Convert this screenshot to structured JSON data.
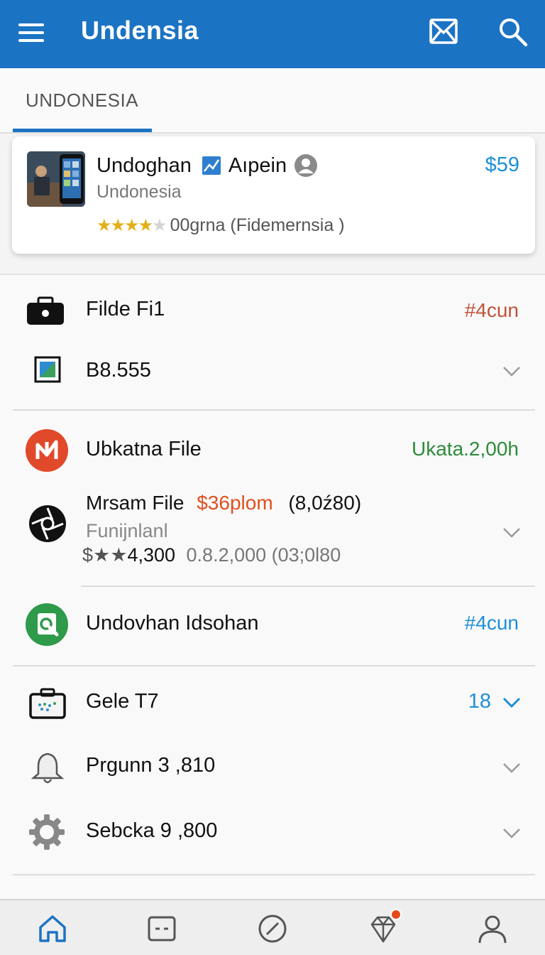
{
  "app": {
    "title": "Undensia"
  },
  "tabs": [
    {
      "label": "UNDONESIA",
      "active": true
    }
  ],
  "card": {
    "name": "Undoghan",
    "name_suffix": "Aıpein",
    "subtitle": "Undonesia",
    "price": "$59",
    "rating_stars": 4,
    "rating_text": "00grna (Fidemernsia )"
  },
  "list": {
    "row1": {
      "label": "Filde Fi1",
      "meta": "#4cun"
    },
    "row2": {
      "label": "B8.555"
    },
    "row3": {
      "label": "Ubkatna File",
      "meta": "Ukata.2,00h"
    },
    "row4": {
      "title": "Mrsam File",
      "price": "$36plom",
      "extra": "(8,0ź80)",
      "subtitle": "Funijnlanl",
      "stats_prefix": "$★★",
      "stats_main": "4,300",
      "stats_rest": "0.8.2,000  (03;0l80"
    },
    "row5": {
      "label": "Undovhan Idsohan",
      "meta": "#4cun"
    },
    "row6": {
      "label": "Gele T7",
      "meta": "18"
    },
    "row7": {
      "label": "Prgunn 3 ,810"
    },
    "row8": {
      "label": "Sebcka 9 ,800"
    }
  },
  "colors": {
    "primary": "#1b73c3",
    "price_blue": "#1d8fd8",
    "meta_red": "#c0533a",
    "meta_green": "#2e8b3a",
    "price_orange": "#e0501e",
    "star": "#e3b01a"
  },
  "icons": {
    "appbar": [
      "menu-icon",
      "mail-icon",
      "search-icon"
    ],
    "bottom_nav": [
      "home-icon",
      "card-icon",
      "compass-icon",
      "diamond-icon",
      "profile-icon"
    ]
  }
}
